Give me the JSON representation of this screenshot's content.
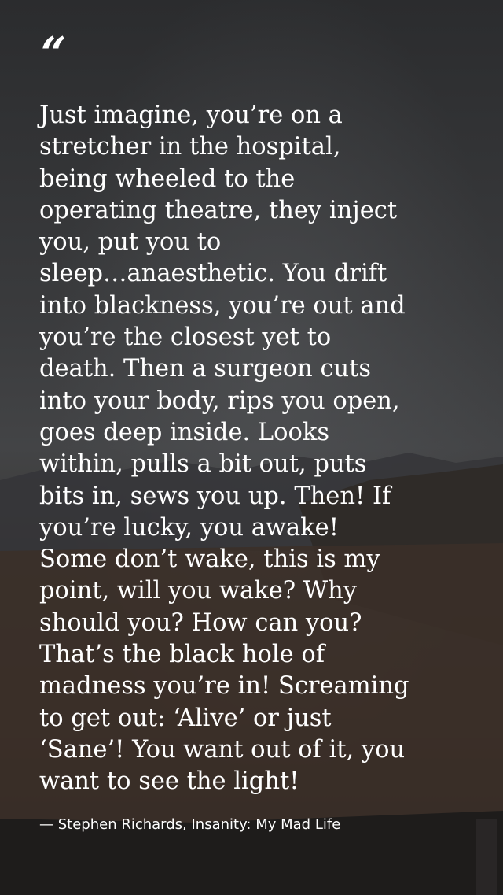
{
  "quote_mark": "“",
  "quote": "Just imagine, you’re on a\nstretcher in the hospital,\nbeing wheeled to the\noperating theatre, they inject\nyou, put you to\nsleep…anaesthetic. You drift\ninto blackness, you’re out and\nyou’re the closest yet to\ndeath.  Then a surgeon cuts\ninto your body, rips you open,\ngoes deep inside. Looks\nwithin, pulls a bit out, puts\nbits in, sews you up. Then! If\nyou’re lucky, you awake!\nSome don’t wake, this is my\npoint, will you wake? Why\nshould you? How can you?\nThat’s the black hole of\nmadness you’re in! Screaming\nto get out: ‘Alive’ or just\n‘Sane’! You want out of it, you\nwant to see the light!",
  "attribution": "— Stephen Richards, Insanity: My Mad Life",
  "colors": {
    "text": "#ffffff",
    "sky_top": "#2b2c2e",
    "sky_mid": "#3c3d3f",
    "ground": "#3a2f28"
  }
}
